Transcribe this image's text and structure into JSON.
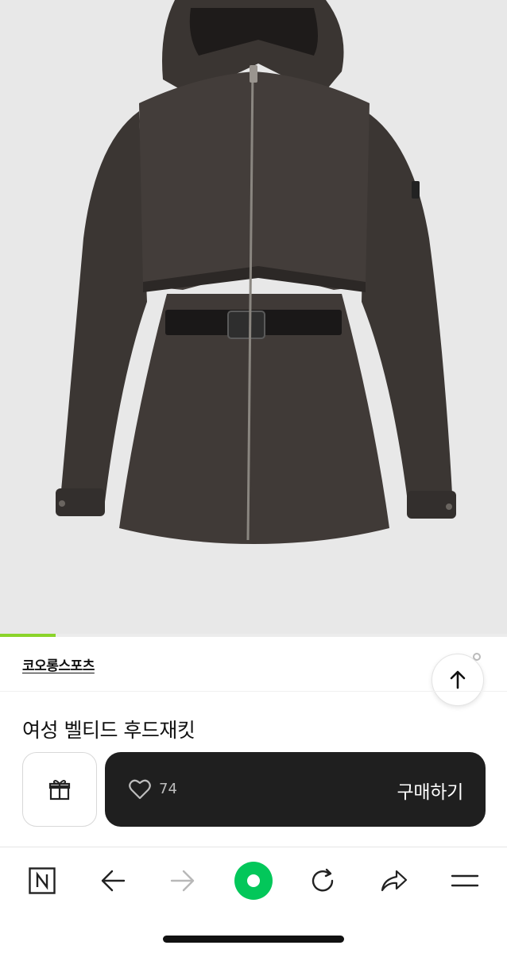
{
  "product": {
    "brand": "코오롱스포츠",
    "title": "여성 벨티드 후드재킷",
    "image_alt": "dark brown belted hooded jacket",
    "image_progress_percent": 11
  },
  "actions": {
    "gift_icon": "gift-icon",
    "like_icon": "heart-icon",
    "like_count": "74",
    "buy_label": "구매하기"
  },
  "browser_nav": {
    "items": [
      "naver-n-icon",
      "back-arrow-icon",
      "forward-arrow-icon",
      "green-home-icon",
      "refresh-icon",
      "share-icon",
      "menu-icon"
    ]
  },
  "colors": {
    "accent": "#8ad42a",
    "buy_bar": "#1f1f1f",
    "home_button": "#03c75a"
  }
}
